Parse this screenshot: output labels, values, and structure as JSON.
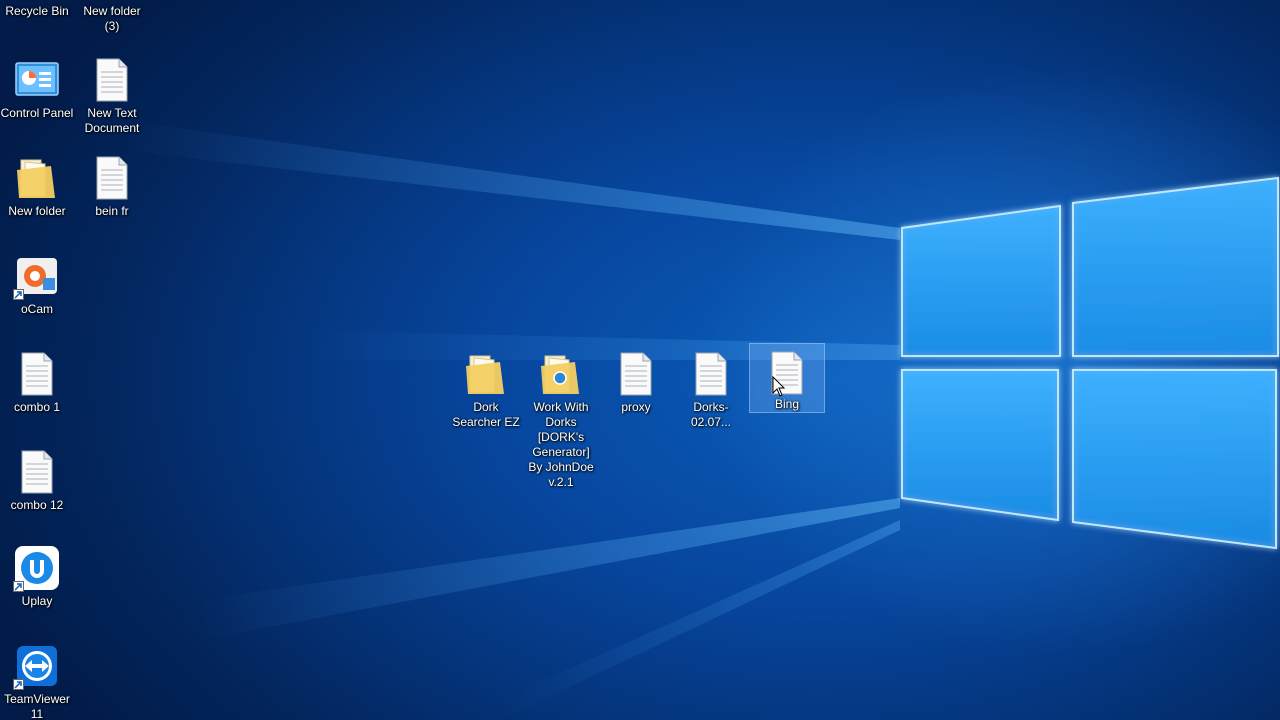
{
  "desktop": {
    "icons": [
      {
        "label": "Recycle Bin",
        "type": "recycle"
      },
      {
        "label": "New folder (3)",
        "type": "folder"
      },
      {
        "label": "Control Panel",
        "type": "control-panel"
      },
      {
        "label": "New Text Document",
        "type": "text"
      },
      {
        "label": "New folder",
        "type": "folder"
      },
      {
        "label": "bein fr",
        "type": "text"
      },
      {
        "label": "oCam",
        "type": "ocam"
      },
      {
        "label": "combo 1",
        "type": "text"
      },
      {
        "label": "combo 12",
        "type": "text"
      },
      {
        "label": "Uplay",
        "type": "uplay"
      },
      {
        "label": "TeamViewer 11",
        "type": "teamviewer"
      },
      {
        "label": "Dork Searcher EZ",
        "type": "folder"
      },
      {
        "label": "Work With Dorks [DORK's Generator] By JohnDoe v.2.1",
        "type": "folder"
      },
      {
        "label": "proxy",
        "type": "text"
      },
      {
        "label": "Dorks-02.07...",
        "type": "text"
      },
      {
        "label": "Bing",
        "type": "text"
      }
    ]
  },
  "colors": {
    "wallpaper_dark": "#021b48",
    "wallpaper_mid": "#0747a0",
    "logo_glow": "#7fd0ff",
    "folder_yellow": "#f4cf62"
  }
}
